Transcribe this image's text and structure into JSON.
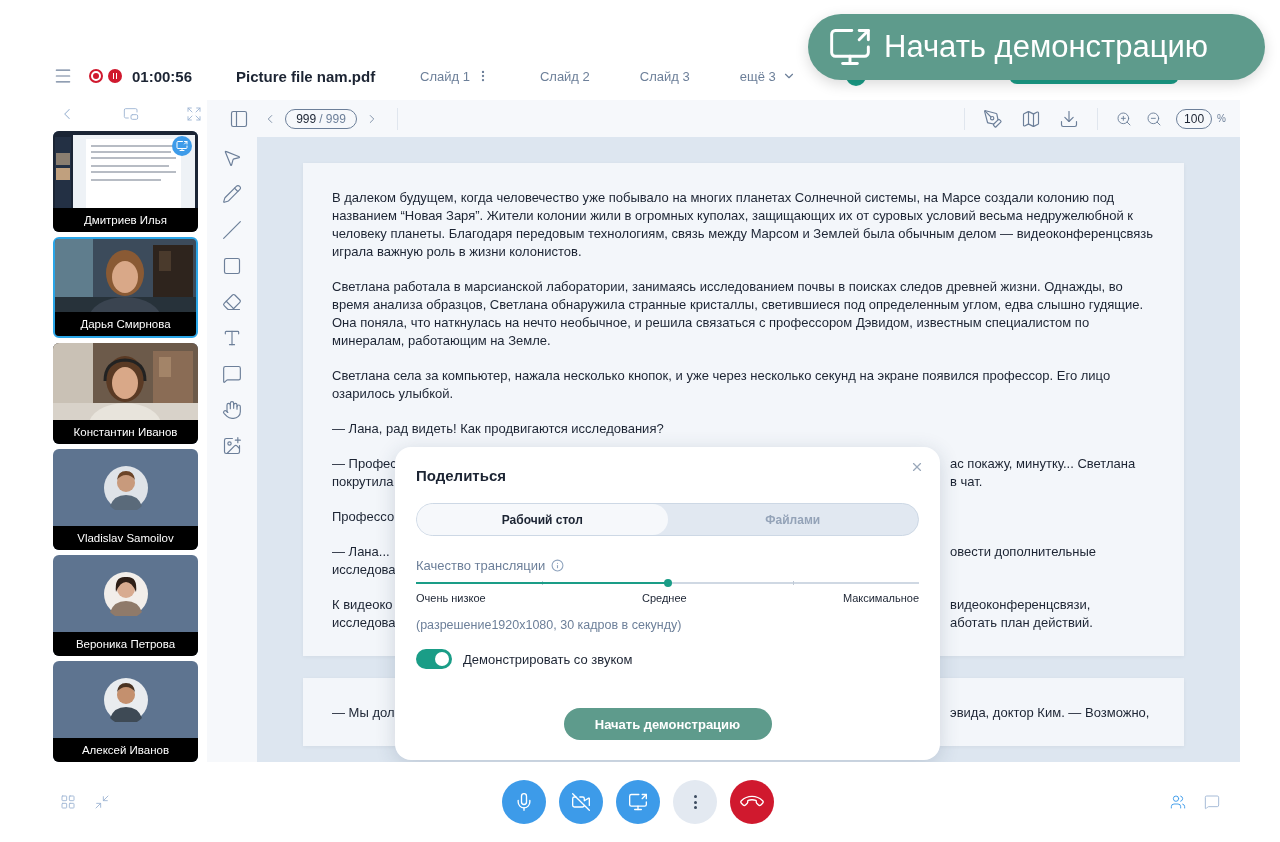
{
  "header": {
    "recording_time": "01:00:56",
    "file_name": "Picture file nam.pdf",
    "slides": [
      {
        "label": "Слайд 1",
        "has_menu": true
      },
      {
        "label": "Слайд 2",
        "has_menu": false
      },
      {
        "label": "Слайд 3",
        "has_menu": false
      }
    ],
    "more_slides": "ещё 3"
  },
  "callout": {
    "label": "Начать демонстрацию"
  },
  "participants": [
    {
      "name": "Дмитриев Илья",
      "kind": "screen",
      "selected": false
    },
    {
      "name": "Дарья Смирнова",
      "kind": "video",
      "selected": true
    },
    {
      "name": "Константин Иванов",
      "kind": "video",
      "selected": false
    },
    {
      "name": "Vladislav Samoilov",
      "kind": "avatar",
      "selected": false
    },
    {
      "name": "Вероника Петрова",
      "kind": "avatar",
      "selected": false
    },
    {
      "name": "Алексей Иванов",
      "kind": "avatar",
      "selected": false
    }
  ],
  "doc_toolbar": {
    "page_current": "999",
    "page_total": "/ 999",
    "zoom": "100",
    "zoom_unit": "%"
  },
  "document": {
    "pages": [
      {
        "paragraphs": [
          "В далеком будущем, когда человечество уже побывало на многих планетах Солнечной системы, на Марсе создали колонию под названием “Новая Заря”. Жители колонии жили в огромных куполах, защищающих их от суровых условий весьма недружелюбной к человеку планеты. Благодаря передовым технологиям, связь между Марсом и Землей была обычным делом — видеоконференцсвязь играла важную роль в жизни колонистов.",
          "Светлана работала в марсианской лаборатории, занимаясь исследованием почвы в поисках следов древней жизни. Однажды, во время анализа образцов, Светлана обнаружила странные кристаллы, светившиеся под определенным углом, едва слышно гудящие. Она поняла, что наткнулась на нечто необычное, и решила связаться с профессором Дэвидом, известным специалистом по минералам, работающим на Земле.",
          "Светлана села за компьютер, нажала несколько кнопок, и уже через несколько секунд на экране появился профессор. Его лицо озарилось улыбкой.",
          "— Лана, рад видеть! Как продвигаются исследования?"
        ],
        "cut_paragraphs": [
          [
            {
              "left": "— Профес",
              "right": "ас покажу, минутку... Светлана"
            },
            {
              "left": "покрутила",
              "right": "в чат."
            }
          ],
          [
            {
              "left": "Профессо"
            }
          ],
          [
            {
              "left": "— Лана...",
              "right": "овести дополнительные"
            },
            {
              "left": "исследова"
            }
          ],
          [
            {
              "left": "К видеоко",
              "right": "видеоконференцсвязи,"
            },
            {
              "left": "исследова",
              "right": "аботать план действий."
            }
          ]
        ]
      },
      {
        "cut_paragraphs": [
          [
            {
              "left": "— Мы дол",
              "right": "эвида, доктор Ким. — Возможно,"
            }
          ]
        ]
      }
    ]
  },
  "share_dialog": {
    "title": "Поделиться",
    "tabs": [
      {
        "label": "Рабочий стол",
        "selected": true
      },
      {
        "label": "Файлами",
        "selected": false
      }
    ],
    "quality": {
      "label": "Качество трансляции",
      "level": 0.5,
      "marks": [
        "Очень низкое",
        "Среднее",
        "Максимальное"
      ],
      "detail": "(разрешение1920x1080, 30 кадров в секунду)"
    },
    "sound": {
      "label": "Демонстрировать со звуком",
      "on": true
    },
    "start_button": "Начать демонстрацию"
  }
}
